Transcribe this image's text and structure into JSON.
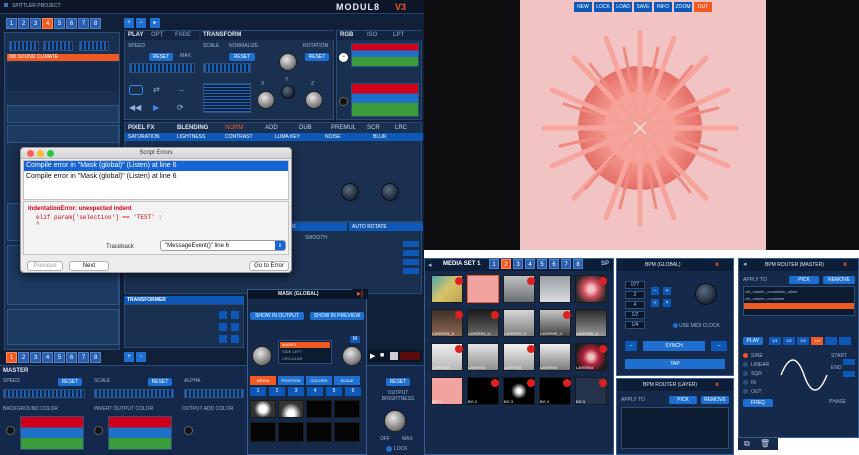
{
  "app": {
    "project_name": "SPITTLER PROJECT",
    "brand": "MODUL8",
    "version": "V3",
    "layer_nums": [
      "1",
      "2",
      "3",
      "4",
      "5",
      "6",
      "7",
      "8"
    ],
    "layer_nums_active_index": 3,
    "layer_item": "0/8 SOUND CLIMATE",
    "bottom_layer_nums": [
      "1",
      "2",
      "3",
      "4",
      "5",
      "6",
      "7",
      "8"
    ]
  },
  "layer_tabs": {
    "play": "PLAY",
    "opt": "OPT",
    "fade": "FADE"
  },
  "transform": {
    "title": "TRANSFORM",
    "scale": "SCALE",
    "normalize": "NORMALIZE",
    "rotation": "ROTATION",
    "reset": "RESET",
    "speed": "SPEED",
    "max": "MAX",
    "knob_labels": [
      "X",
      "Y",
      "Z"
    ]
  },
  "rgb_tabs": [
    "RGB",
    "ISO",
    "LPT"
  ],
  "pixel_fx": {
    "title": "PIXEL FX",
    "blending": "BLENDING",
    "modes": [
      "NORM",
      "ADD",
      "DUB",
      "PREMUL",
      "SCR",
      "LRC"
    ],
    "cols": [
      "SATURATION",
      "LIGHTNESS",
      "CONTRAST",
      "LUMA KEY",
      "NOISE",
      "BLUR"
    ]
  },
  "color_section": {
    "color": "COLOR",
    "auto_rotate": "AUTO ROTATE",
    "smooth": "SMOOTH"
  },
  "transformer": "TRANSFORMER",
  "master": {
    "title": "MASTER",
    "speed": "SPEED",
    "scale": "SCALE",
    "alpha": "ALPHA",
    "reset": "RESET",
    "background_color": "BACKGROUND COLOR",
    "invert_output_color": "INVERT OUTPUT COLOR",
    "output_add_color": "OUTPUT ADD COLOR",
    "output_brightness": "OUTPUT BRIGHTNESS",
    "off": "OFF",
    "max": "MAX",
    "lock": "LOCK"
  },
  "script_errors": {
    "title": "Script Errors",
    "errors": [
      "Compile error in \"Mask (global)\" (Listen) at line 6",
      "Compile error in \"Mask (global)\" (Listen) at line 6"
    ],
    "message": "IndentationError: unexpected indent",
    "code_line": "elif param['selection'] == 'TEST' :",
    "code_caret": "^",
    "traceback_label": "Traceback",
    "traceback_value": "\"MessageEvent()\" line 6",
    "previous": "Previous",
    "next": "Next",
    "goto": "Go to Error"
  },
  "mask_panel": {
    "title": "MASK (GLOBAL)",
    "show_output": "SHOW IN OUTPUT",
    "show_preview": "SHOW IN PREVIEW",
    "list": [
      "MASKS",
      "SIDE LEFT",
      "CIRCULAR"
    ],
    "list_selected_index": 0,
    "tabs": [
      "MEDIA",
      "POSITION",
      "COLORS",
      "SCALE"
    ],
    "tab_nums": [
      "1",
      "2",
      "3",
      "4",
      "5",
      "6"
    ]
  },
  "preview_header_buttons": [
    "NEW",
    "LOCK",
    "LOAD",
    "SAVE",
    "INFO",
    "ZOOM",
    "OUT"
  ],
  "media_set": {
    "title": "MEDIA SET 1",
    "nums": [
      "1",
      "2",
      "3",
      "4",
      "5",
      "6",
      "7",
      "8"
    ],
    "active_index": 1,
    "sp": "SP",
    "row2_labels": [
      "LAYER03_U",
      "LAYER04_U",
      "LAYER03_U",
      "LAYER05_U",
      "LAYER06_U"
    ],
    "row3_labels": [
      "LAYER03",
      "LAYER03",
      "LAYER03",
      "LAYER03",
      "LAYER04"
    ],
    "row4_labels": [
      "BG 1",
      "BG 2",
      "BG 3",
      "BG 4",
      "BG 5"
    ]
  },
  "bpm_global": {
    "title": "BPM (GLOBAL)",
    "values": [
      "077",
      "2",
      "4",
      "1/2",
      "1/4"
    ],
    "tap": "TAP",
    "synch": "SYNCH",
    "use_midi_clock": "USE MIDI CLOCK"
  },
  "bpm_router_layer": {
    "title": "BPM ROUTER (LAYER)",
    "apply_to": "APPLY TO",
    "pick": "PICK",
    "remove": "REMOVE"
  },
  "bpm_router_master": {
    "title": "BPM ROUTER (MASTER)",
    "apply_to": "APPLY TO",
    "pick": "PICK",
    "remove": "REMOVE",
    "entries": [
      "ctrl_master_crossfader_slider",
      "ctrl_master_crossfade"
    ],
    "play": "PLAY",
    "divs": [
      "1/1",
      "1/2",
      "1/3",
      "1/4"
    ],
    "options": [
      "SINE",
      "LINEAR",
      "SQR",
      "IN",
      "OUT"
    ],
    "start": "START",
    "end": "END",
    "phase": "PHASE",
    "freq": "FREQ"
  },
  "colors": {
    "accent_orange": "#f05a22",
    "panel_blue": "#1a3050",
    "button_blue": "#1f6fd1",
    "error_red": "#d0021b",
    "preview_pink": "#f2c3c3",
    "sphere_coral": "#f0877f"
  }
}
